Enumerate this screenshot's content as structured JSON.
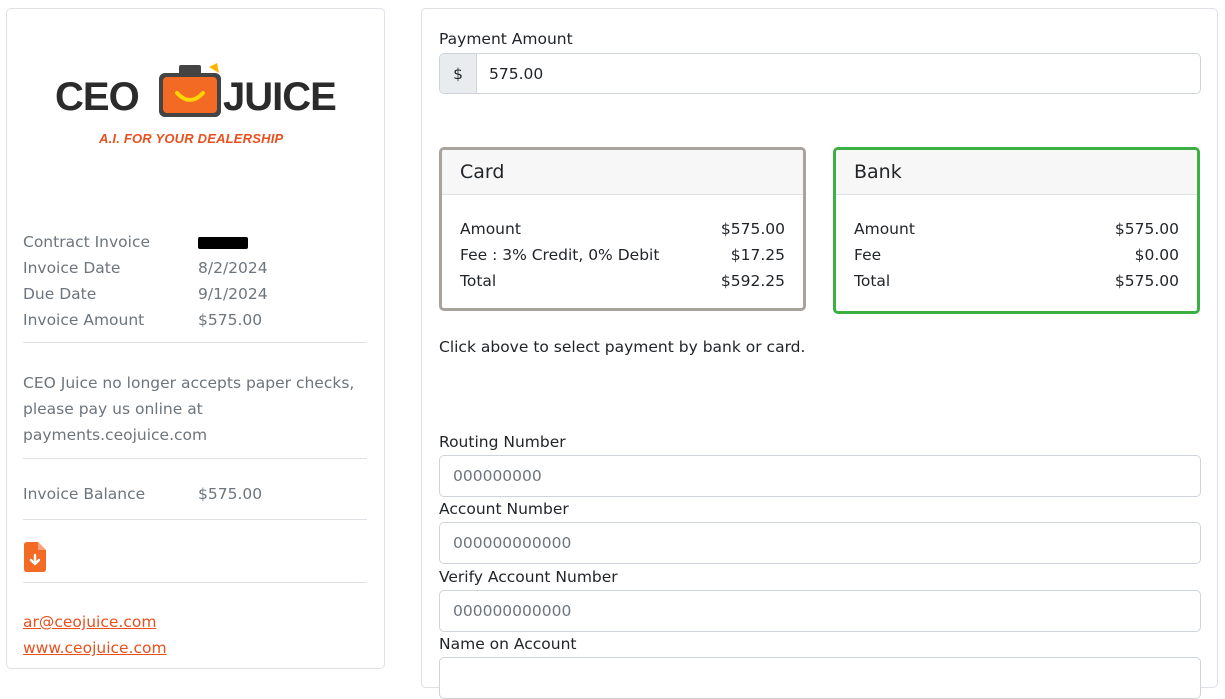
{
  "logo": {
    "word1": "CEO",
    "word2": "JUICE",
    "tagline": "A.I. FOR YOUR DEALERSHIP"
  },
  "invoice": {
    "rows": [
      {
        "label": "Contract Invoice",
        "value": ""
      },
      {
        "label": "Invoice Date",
        "value": "8/2/2024"
      },
      {
        "label": "Due Date",
        "value": "9/1/2024"
      },
      {
        "label": "Invoice Amount",
        "value": "$575.00"
      }
    ],
    "notice": "CEO Juice no longer accepts paper checks, please pay us online at payments.ceojuice.com",
    "balance_label": "Invoice Balance",
    "balance_value": "$575.00"
  },
  "contact": {
    "email": "ar@ceojuice.com",
    "website": "www.ceojuice.com"
  },
  "payment": {
    "amount_label": "Payment Amount",
    "currency_symbol": "$",
    "amount_value": "575.00",
    "hint": "Click above to select payment by bank or card."
  },
  "card": {
    "title": "Card",
    "amount_label": "Amount",
    "amount": "$575.00",
    "fee_label": "Fee : 3% Credit, 0% Debit",
    "fee": "$17.25",
    "total_label": "Total",
    "total": "$592.25"
  },
  "bank": {
    "title": "Bank",
    "amount_label": "Amount",
    "amount": "$575.00",
    "fee_label": "Fee",
    "fee": "$0.00",
    "total_label": "Total",
    "total": "$575.00",
    "selected_color": "#3cb043"
  },
  "form": {
    "routing_label": "Routing Number",
    "routing_placeholder": "000000000",
    "account_label": "Account Number",
    "account_placeholder": "000000000000",
    "verify_label": "Verify Account Number",
    "verify_placeholder": "000000000000",
    "name_label": "Name on Account"
  },
  "colors": {
    "brand_orange": "#e8501e",
    "muted_text": "#6c757d"
  }
}
